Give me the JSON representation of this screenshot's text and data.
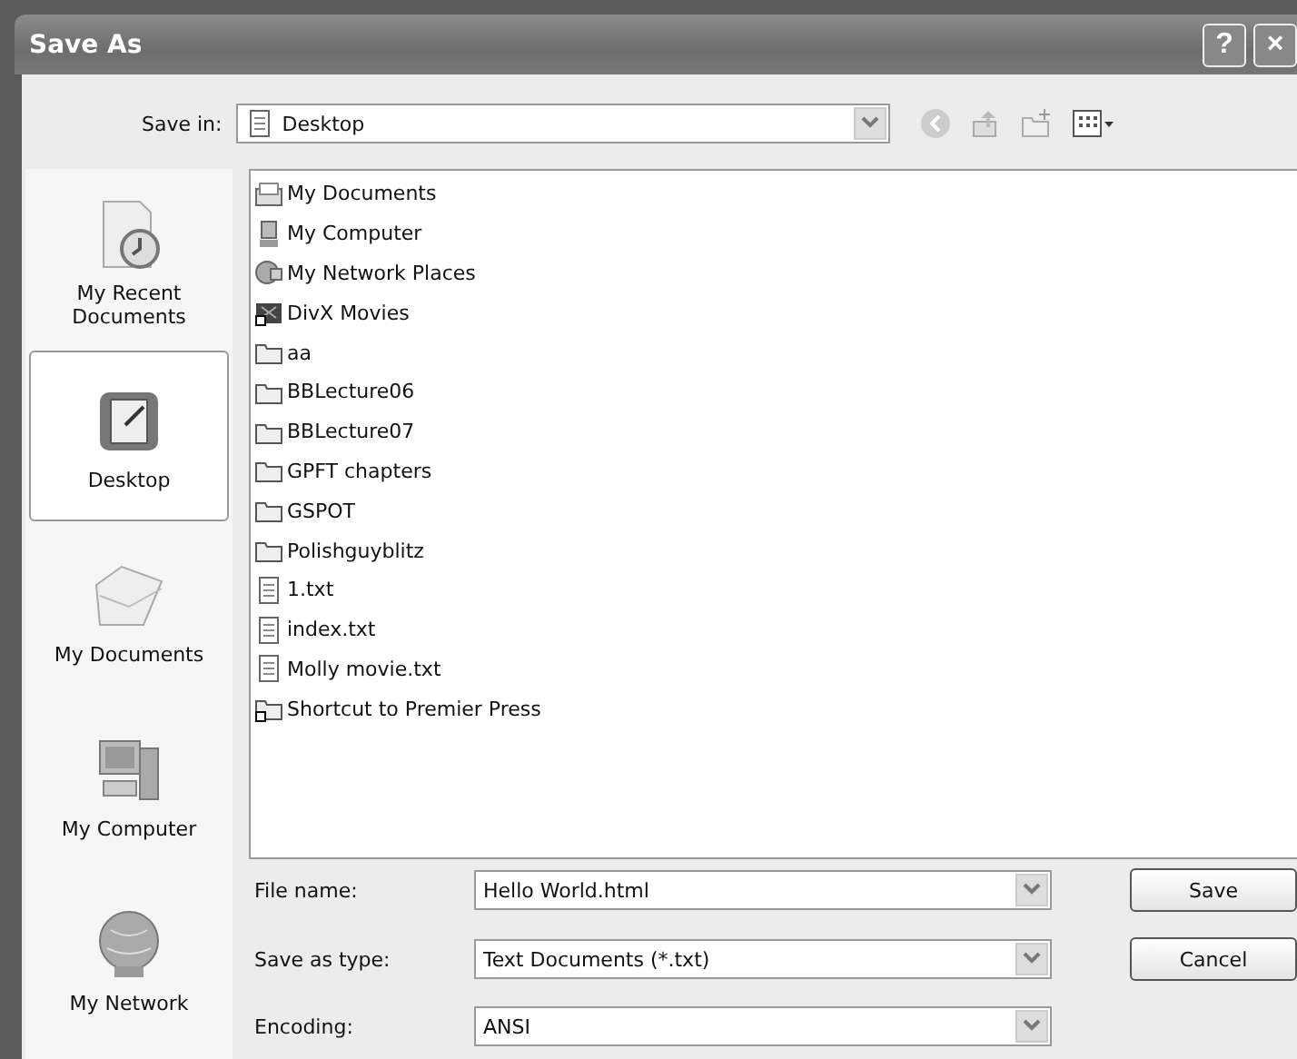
{
  "window": {
    "title": "Save As",
    "help_button": "?",
    "close_button": "×"
  },
  "save_in": {
    "label": "Save in:",
    "value": "Desktop"
  },
  "places": [
    {
      "label": "My Recent Documents",
      "kind": "recent",
      "selected": false
    },
    {
      "label": "Desktop",
      "kind": "desktop",
      "selected": true
    },
    {
      "label": "My Documents",
      "kind": "documents",
      "selected": false
    },
    {
      "label": "My Computer",
      "kind": "computer",
      "selected": false
    },
    {
      "label": "My Network",
      "kind": "network",
      "selected": false
    }
  ],
  "files": [
    {
      "name": "My Documents",
      "kind": "documents"
    },
    {
      "name": "My Computer",
      "kind": "computer"
    },
    {
      "name": "My Network Places",
      "kind": "network"
    },
    {
      "name": "DivX Movies",
      "kind": "shortcut"
    },
    {
      "name": "aa",
      "kind": "folder"
    },
    {
      "name": "BBLecture06",
      "kind": "folder"
    },
    {
      "name": "BBLecture07",
      "kind": "folder"
    },
    {
      "name": "GPFT chapters",
      "kind": "folder"
    },
    {
      "name": "GSPOT",
      "kind": "folder"
    },
    {
      "name": "Polishguyblitz",
      "kind": "folder"
    },
    {
      "name": "1.txt",
      "kind": "text"
    },
    {
      "name": "index.txt",
      "kind": "text"
    },
    {
      "name": "Molly movie.txt",
      "kind": "text"
    },
    {
      "name": "Shortcut to Premier Press",
      "kind": "folder-shortcut"
    }
  ],
  "fields": [
    {
      "label": "File name:",
      "value": "Hello World.html"
    },
    {
      "label": "Save as type:",
      "value": "Text Documents (*.txt)"
    },
    {
      "label": "Encoding:",
      "value": "ANSI"
    }
  ],
  "buttons": [
    "Save",
    "Cancel"
  ]
}
